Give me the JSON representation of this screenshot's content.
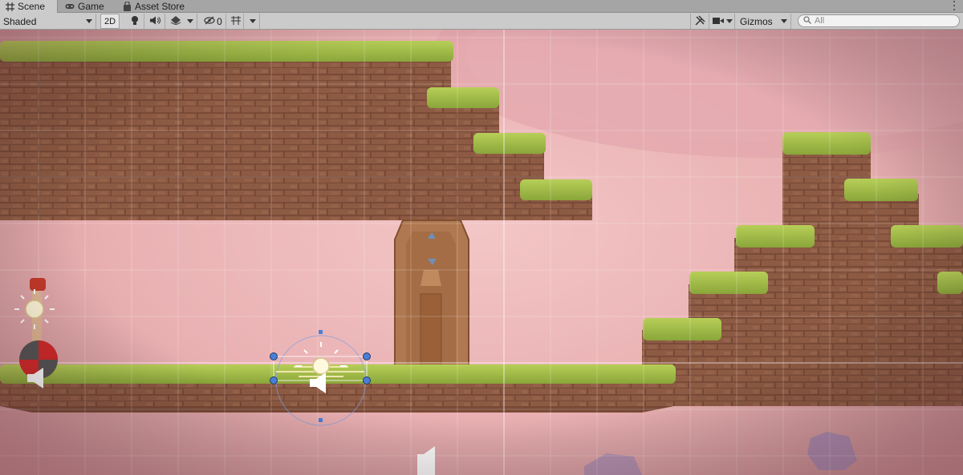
{
  "tabs": [
    {
      "label": "Scene",
      "icon": "grid-icon",
      "active": true
    },
    {
      "label": "Game",
      "icon": "gamepad-icon",
      "active": false
    },
    {
      "label": "Asset Store",
      "icon": "bag-icon",
      "active": false
    }
  ],
  "toolbar": {
    "draw_mode": "Shaded",
    "mode_2d": "2D",
    "hidden_count": "0",
    "gizmos_label": "Gizmos",
    "search_placeholder": "All"
  },
  "colors": {
    "sky": "#efbcbc",
    "grass": "#a8c24a",
    "rock": "#8e5c44",
    "door": "#b57a4e",
    "selection": "#4a7fd6"
  }
}
